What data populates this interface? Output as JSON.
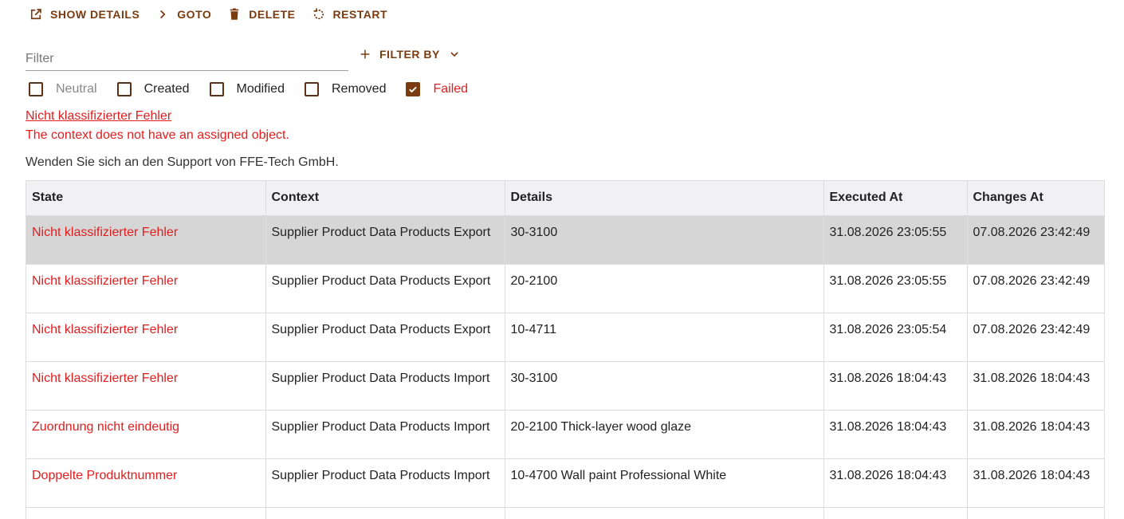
{
  "toolbar": {
    "show_details": "SHOW DETAILS",
    "goto": "GOTO",
    "delete": "DELETE",
    "restart": "RESTART"
  },
  "filter": {
    "placeholder": "Filter",
    "filter_by": "FILTER BY"
  },
  "checkboxes": [
    {
      "label": "Neutral",
      "checked": false
    },
    {
      "label": "Created",
      "checked": false
    },
    {
      "label": "Modified",
      "checked": false
    },
    {
      "label": "Removed",
      "checked": false
    },
    {
      "label": "Failed",
      "checked": true
    }
  ],
  "error": {
    "title": "Nicht klassifizierter Fehler",
    "message": "The context does not have an assigned object.",
    "support": "Wenden Sie sich an den Support von FFE-Tech GmbH."
  },
  "table": {
    "headers": [
      "State",
      "Context",
      "Details",
      "Executed At",
      "Changes At"
    ],
    "rows": [
      {
        "state": "Nicht klassifizierter Fehler",
        "context": "Supplier Product Data Products Export",
        "details": "30-3100",
        "executed": "31.08.2026 23:05:55",
        "changes": "07.08.2026 23:42:49"
      },
      {
        "state": "Nicht klassifizierter Fehler",
        "context": "Supplier Product Data Products Export",
        "details": "20-2100",
        "executed": "31.08.2026 23:05:55",
        "changes": "07.08.2026 23:42:49"
      },
      {
        "state": "Nicht klassifizierter Fehler",
        "context": "Supplier Product Data Products Export",
        "details": "10-4711",
        "executed": "31.08.2026 23:05:54",
        "changes": "07.08.2026 23:42:49"
      },
      {
        "state": "Nicht klassifizierter Fehler",
        "context": "Supplier Product Data Products Import",
        "details": "30-3100",
        "executed": "31.08.2026 18:04:43",
        "changes": "31.08.2026 18:04:43"
      },
      {
        "state": "Zuordnung nicht eindeutig",
        "context": "Supplier Product Data Products Import",
        "details": "20-2100 Thick-layer wood glaze",
        "executed": "31.08.2026 18:04:43",
        "changes": "31.08.2026 18:04:43"
      },
      {
        "state": "Doppelte Produktnummer",
        "context": "Supplier Product Data Products Import",
        "details": "10-4700 Wall paint Professional White",
        "executed": "31.08.2026 18:04:43",
        "changes": "31.08.2026 18:04:43"
      }
    ]
  },
  "colors": {
    "accent": "#7a3b10",
    "error": "#e11d1d",
    "selected_row": "#d6d6d6",
    "header_bg": "#f1f1f3"
  }
}
